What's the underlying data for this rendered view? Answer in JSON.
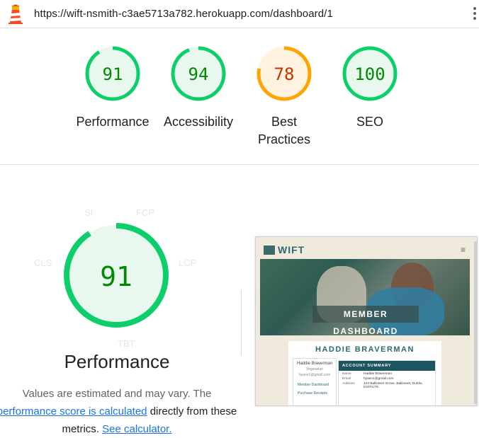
{
  "browser": {
    "url": "https://wift-nsmith-c3ae5713a782.herokuapp.com/dashboard/1"
  },
  "colors": {
    "pass": "#0cce6b",
    "pass_fill": "#e8f8ee",
    "pass_text": "#008800",
    "average": "#ffa400",
    "average_fill": "#fff3e0",
    "average_text": "#c33300"
  },
  "scores": [
    {
      "value": "91",
      "label": "Performance",
      "rating": "pass",
      "fraction": 0.91
    },
    {
      "value": "94",
      "label": "Accessibility",
      "rating": "pass",
      "fraction": 0.94
    },
    {
      "value": "78",
      "label_line1": "Best",
      "label_line2": "Practices",
      "rating": "average",
      "fraction": 0.78
    },
    {
      "value": "100",
      "label": "SEO",
      "rating": "pass",
      "fraction": 1.0
    }
  ],
  "performance": {
    "score": "91",
    "fraction": 0.91,
    "title": "Performance",
    "metrics": {
      "si": "SI",
      "fcp": "FCP",
      "lcp": "LCP",
      "tbt": "TBT",
      "cls": "CLS"
    },
    "desc_part1": "Values are estimated and may vary. The",
    "desc_link1": "performance score is calculated",
    "desc_part2": "directly from these",
    "desc_part3": "metrics.",
    "desc_link2": "See calculator."
  },
  "screenshot": {
    "logo": "WIFT",
    "hamburger": "≡",
    "banner": "MEMBER DASHBOARD",
    "member_name": "HADDIE BRAVERMAN",
    "profile_name": "Haddie Braverman",
    "profile_diet": "Vegetarian",
    "profile_email": "hyann1@gmail.com",
    "nav_dashboard": "Member Dashboard",
    "nav_receipts": "Purchase Receipts",
    "summary_title": "ACCOUNT SUMMARY",
    "row_name_label": "Name",
    "row_name_value": "Haddie Braverman",
    "row_email_label": "Email",
    "row_email_value": "hyann1@gmail.com",
    "row_address_label": "Address",
    "row_address_value": "123 Ballinteer Grove, Ballinteer, Dublin, D16YU78"
  }
}
